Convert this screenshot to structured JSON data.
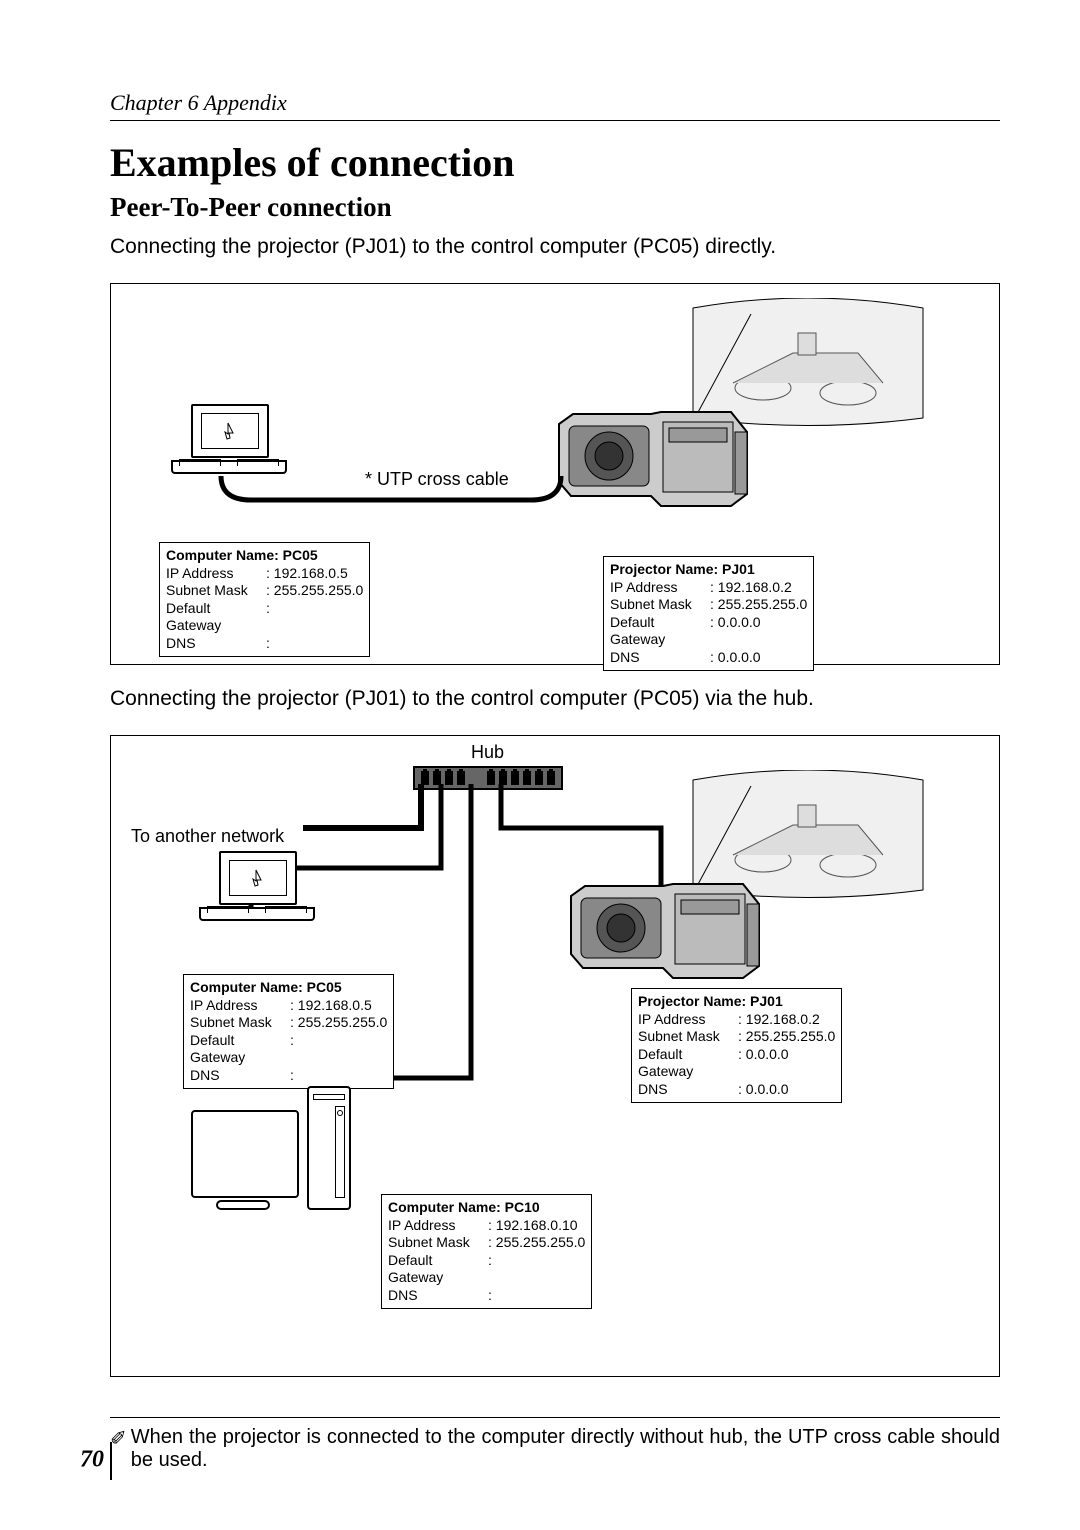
{
  "chapter": "Chapter 6 Appendix",
  "title": "Examples of connection",
  "subtitle": "Peer-To-Peer connection",
  "intro1": "Connecting the projector (PJ01) to the control computer (PC05) directly.",
  "intro2": "Connecting the projector (PJ01) to the control computer (PC05) via the hub.",
  "diagram1": {
    "cable_label": "* UTP cross cable",
    "pc": {
      "title": "Computer Name: PC05",
      "ip_k": "IP Address",
      "ip_v": "192.168.0.5",
      "mask_k": "Subnet Mask",
      "mask_v": "255.255.255.0",
      "gw_k": "Default Gateway",
      "gw_v": "",
      "dns_k": "DNS",
      "dns_v": ""
    },
    "pj": {
      "title": "Projector Name: PJ01",
      "ip_k": "IP Address",
      "ip_v": "192.168.0.2",
      "mask_k": "Subnet Mask",
      "mask_v": "255.255.255.0",
      "gw_k": "Default Gateway",
      "gw_v": "0.0.0.0",
      "dns_k": "DNS",
      "dns_v": "0.0.0.0"
    }
  },
  "diagram2": {
    "hub_label": "Hub",
    "to_net": "To another network",
    "pc05": {
      "title": "Computer Name: PC05",
      "ip_k": "IP Address",
      "ip_v": "192.168.0.5",
      "mask_k": "Subnet Mask",
      "mask_v": "255.255.255.0",
      "gw_k": "Default Gateway",
      "gw_v": "",
      "dns_k": "DNS",
      "dns_v": ""
    },
    "pj": {
      "title": "Projector Name: PJ01",
      "ip_k": "IP Address",
      "ip_v": "192.168.0.2",
      "mask_k": "Subnet Mask",
      "mask_v": "255.255.255.0",
      "gw_k": "Default Gateway",
      "gw_v": "0.0.0.0",
      "dns_k": "DNS",
      "dns_v": "0.0.0.0"
    },
    "pc10": {
      "title": "Computer Name: PC10",
      "ip_k": "IP Address",
      "ip_v": "192.168.0.10",
      "mask_k": "Subnet Mask",
      "mask_v": "255.255.255.0",
      "gw_k": "Default Gateway",
      "gw_v": "",
      "dns_k": "DNS",
      "dns_v": ""
    }
  },
  "footnote_icon": "✐",
  "footnote": "When the projector is connected to the computer directly without hub, the UTP cross cable should be used.",
  "page_number": "70"
}
